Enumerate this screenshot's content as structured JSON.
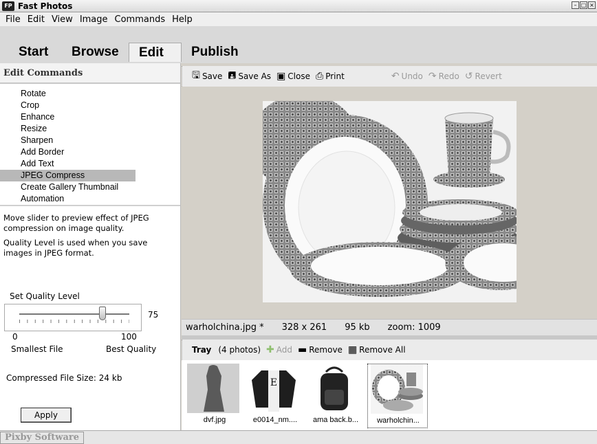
{
  "window": {
    "title": "Fast Photos",
    "logo": "FP"
  },
  "menu": [
    "File",
    "Edit",
    "View",
    "Image",
    "Commands",
    "Help"
  ],
  "tabs": [
    {
      "label": "Start"
    },
    {
      "label": "Browse"
    },
    {
      "label": "Edit",
      "active": true
    },
    {
      "label": "Publish"
    }
  ],
  "left": {
    "header": "Edit Commands",
    "commands": [
      "Rotate",
      "Crop",
      "Enhance",
      "Resize",
      "Sharpen",
      "Add Border",
      "Add Text",
      "JPEG Compress",
      "Create Gallery Thumbnail",
      "Automation"
    ],
    "selected_command": "JPEG Compress",
    "help1": "Move slider to preview effect of JPEG compression on image quality.",
    "help2": "Quality Level is used when you save images in JPEG format.",
    "quality_label": "Set Quality Level",
    "quality_value": "75",
    "quality_level": 75,
    "slider_min": "0",
    "slider_max": "100",
    "min_label": "Smallest File",
    "max_label": "Best Quality",
    "compressed_size": "Compressed File Size:  24 kb",
    "apply_label": "Apply"
  },
  "toolbar": {
    "save": "Save",
    "save_as": "Save As",
    "close": "Close",
    "print": "Print",
    "undo": "Undo",
    "redo": "Redo",
    "revert": "Revert"
  },
  "status": {
    "filename": "warholchina.jpg *",
    "dimensions": "328 x 261",
    "size": "95 kb",
    "zoom": "zoom: 1009"
  },
  "tray": {
    "title": "Tray",
    "count": "(4 photos)",
    "add": "Add",
    "remove": "Remove",
    "remove_all": "Remove All",
    "items": [
      {
        "caption": "dvf.jpg"
      },
      {
        "caption": "e0014_nm...."
      },
      {
        "caption": "ama back.b..."
      },
      {
        "caption": "warholchin..."
      }
    ]
  },
  "footer": {
    "brand": "Pixby Software"
  },
  "colors": {
    "panel": "#d4d0c8",
    "selected": "#b8b8b8",
    "disabled": "#9a9a9a"
  }
}
